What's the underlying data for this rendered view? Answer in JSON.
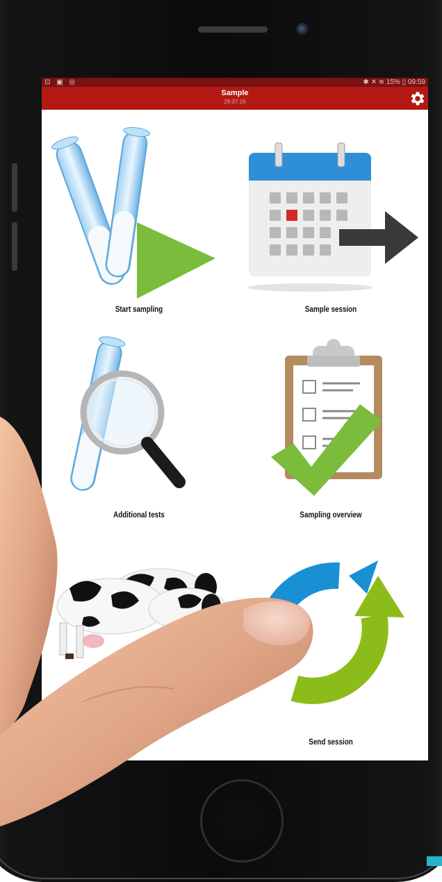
{
  "status_bar": {
    "left_icons": "⊡ ▣ ◎",
    "right_text": "✱ ✕ ≋ 15% ▯ 09:59"
  },
  "app_bar": {
    "title": "Sample",
    "subtitle": "28.07.19"
  },
  "tiles": [
    {
      "id": "start-sampling",
      "label": "Start sampling",
      "icon": "test-tubes-play-icon"
    },
    {
      "id": "sample-session",
      "label": "Sample session",
      "icon": "calendar-arrow-icon"
    },
    {
      "id": "additional-tests",
      "label": "Additional tests",
      "icon": "test-tube-magnifier-icon"
    },
    {
      "id": "sampling-overview",
      "label": "Sampling overview",
      "icon": "clipboard-check-icon"
    },
    {
      "id": "animals",
      "label": "",
      "icon": "cows-icon"
    },
    {
      "id": "send-session",
      "label": "Send session",
      "icon": "sync-arrows-icon"
    }
  ],
  "colors": {
    "app_bar": "#b31914",
    "status_bar": "#7a1210",
    "play_green": "#7cbc3d",
    "calendar_blue": "#2e8fd6",
    "sync_blue": "#1a90d4",
    "sync_green": "#8cbc1a"
  }
}
